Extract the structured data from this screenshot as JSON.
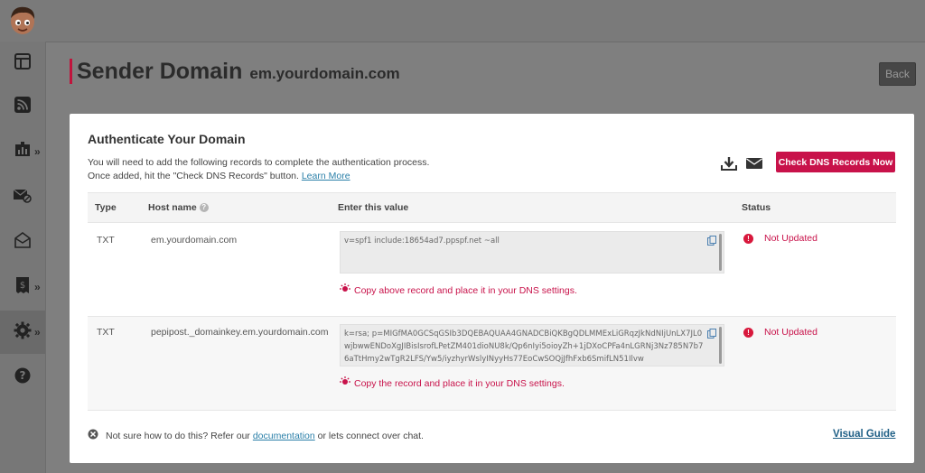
{
  "page": {
    "title": "Sender Domain",
    "domain": "em.yourdomain.com",
    "back_label": "Back"
  },
  "sidebar": {
    "items": [
      {
        "icon": "dashboard-icon",
        "has_chevron": false
      },
      {
        "icon": "rss-icon",
        "has_chevron": false
      },
      {
        "icon": "chart-icon",
        "has_chevron": true
      },
      {
        "icon": "mail-blocked-icon",
        "has_chevron": false
      },
      {
        "icon": "open-mail-icon",
        "has_chevron": false
      },
      {
        "icon": "billing-icon",
        "has_chevron": true
      },
      {
        "icon": "gear-icon",
        "has_chevron": true
      },
      {
        "icon": "help-icon",
        "has_chevron": false
      }
    ],
    "chevron": "»",
    "help_glyph": "?"
  },
  "modal": {
    "title": "Authenticate Your Domain",
    "desc_line1": "You will need to add the following records to complete the authentication process.",
    "desc_line2": "Once added, hit the \"Check DNS Records\" button.",
    "learn_more": "Learn More",
    "check_button": "Check DNS Records Now",
    "columns": {
      "type": "Type",
      "host": "Host name",
      "value": "Enter this value",
      "status": "Status"
    },
    "help_glyph": "?",
    "status_glyph": "!",
    "records": [
      {
        "type": "TXT",
        "host": "em.yourdomain.com",
        "value": "v=spf1 include:18654ad7.ppspf.net ~all",
        "hint": "Copy above record and place it in your DNS settings.",
        "status": "Not Updated"
      },
      {
        "type": "TXT",
        "host": "pepipost._domainkey.em.yourdomain.com",
        "value": "k=rsa; p=MIGfMA0GCSqGSIb3DQEBAQUAA4GNADCBiQKBgQDLMMExLiGRqzJkNdNIjUnLX7JL0wjbwwENDoXgJIBisIsrofLPetZM401dioNU8k/Qp6nIyi5oioyZh+1jDXoCPFa4nLGRNj3Nz785N7b76aTtHmy2wTgR2LFS/Yw5/iyzhyrWslyINyyHs77EoCwSOQjJfhFxb6SmifLN51Ilvw",
        "hint": "Copy the record and place it in your DNS settings.",
        "status": "Not Updated"
      }
    ],
    "footer_prefix": "Not sure how to do this? Refer our",
    "footer_link": "documentation",
    "footer_suffix": "or lets connect over chat.",
    "visual_guide": "Visual Guide"
  },
  "colors": {
    "accent": "#c8124a",
    "link": "#2a7fa8"
  }
}
